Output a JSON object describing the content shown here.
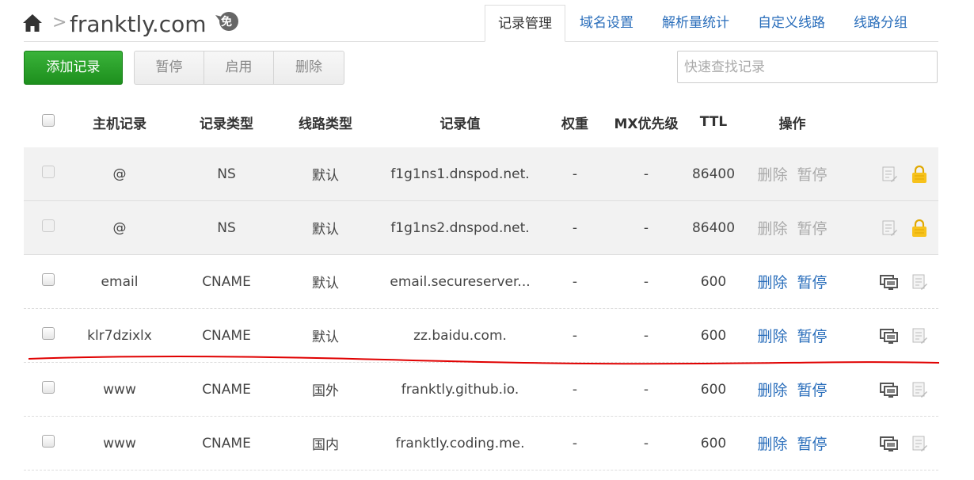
{
  "header": {
    "domain": "franktly.com",
    "crumb_separator": ">",
    "badge": "免"
  },
  "tabs": [
    {
      "label": "记录管理",
      "active": true
    },
    {
      "label": "域名设置",
      "active": false
    },
    {
      "label": "解析量统计",
      "active": false
    },
    {
      "label": "自定义线路",
      "active": false
    },
    {
      "label": "线路分组",
      "active": false
    }
  ],
  "toolbar": {
    "add_label": "添加记录",
    "pause_label": "暂停",
    "enable_label": "启用",
    "delete_label": "删除",
    "search_placeholder": "快速查找记录"
  },
  "table": {
    "headers": {
      "host": "主机记录",
      "type": "记录类型",
      "line": "线路类型",
      "value": "记录值",
      "weight": "权重",
      "mx": "MX优先级",
      "ttl": "TTL",
      "ops": "操作"
    },
    "rows": [
      {
        "host": "@",
        "type": "NS",
        "line": "默认",
        "value": "f1g1ns1.dnspod.net.",
        "weight": "-",
        "mx": "-",
        "ttl": "86400",
        "del": "删除",
        "pause": "暂停",
        "system": true
      },
      {
        "host": "@",
        "type": "NS",
        "line": "默认",
        "value": "f1g1ns2.dnspod.net.",
        "weight": "-",
        "mx": "-",
        "ttl": "86400",
        "del": "删除",
        "pause": "暂停",
        "system": true
      },
      {
        "host": "email",
        "type": "CNAME",
        "line": "默认",
        "value": "email.secureserver...",
        "weight": "-",
        "mx": "-",
        "ttl": "600",
        "del": "删除",
        "pause": "暂停",
        "system": false
      },
      {
        "host": "klr7dzixlx",
        "type": "CNAME",
        "line": "默认",
        "value": "zz.baidu.com.",
        "weight": "-",
        "mx": "-",
        "ttl": "600",
        "del": "删除",
        "pause": "暂停",
        "system": false
      },
      {
        "host": "www",
        "type": "CNAME",
        "line": "国外",
        "value": "franktly.github.io.",
        "weight": "-",
        "mx": "-",
        "ttl": "600",
        "del": "删除",
        "pause": "暂停",
        "system": false
      },
      {
        "host": "www",
        "type": "CNAME",
        "line": "国内",
        "value": "franktly.coding.me.",
        "weight": "-",
        "mx": "-",
        "ttl": "600",
        "del": "删除",
        "pause": "暂停",
        "system": false
      }
    ]
  },
  "icons": {
    "home": "home-icon",
    "badge": "free-badge-icon",
    "note": "note-icon",
    "lock": "lock-icon",
    "monitor": "monitor-icon"
  },
  "colors": {
    "link": "#2a6ebb",
    "add_button": "#1d8f1d",
    "lock": "#f0b400",
    "annotation": "#e00000"
  }
}
